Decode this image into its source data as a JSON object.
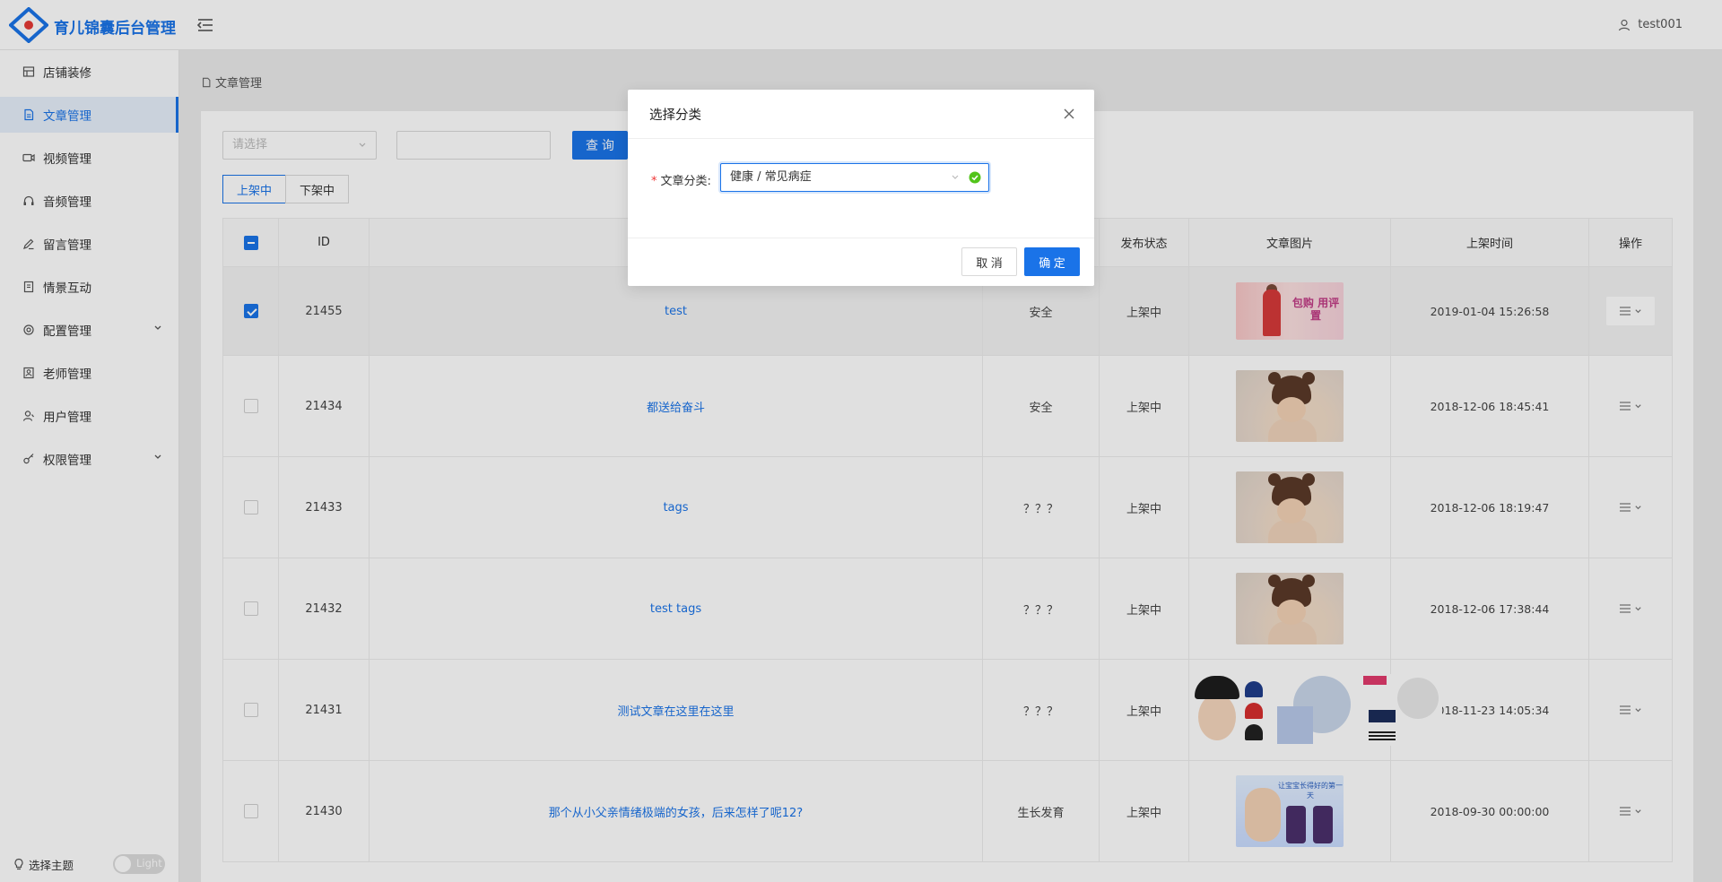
{
  "app": {
    "brand": "育儿锦囊后台管理",
    "user": "test001"
  },
  "sidebar": {
    "items": [
      {
        "label": "店铺装修",
        "icon": "store-icon"
      },
      {
        "label": "文章管理",
        "icon": "document-icon",
        "active": true
      },
      {
        "label": "视频管理",
        "icon": "video-icon"
      },
      {
        "label": "音频管理",
        "icon": "audio-icon"
      },
      {
        "label": "留言管理",
        "icon": "comment-icon"
      },
      {
        "label": "情景互动",
        "icon": "book-icon"
      },
      {
        "label": "配置管理",
        "icon": "settings-icon",
        "expandable": true
      },
      {
        "label": "老师管理",
        "icon": "teacher-icon"
      },
      {
        "label": "用户管理",
        "icon": "user-icon"
      },
      {
        "label": "权限管理",
        "icon": "key-icon",
        "expandable": true
      }
    ],
    "theme_label": "选择主题",
    "theme_toggle": "Light"
  },
  "breadcrumb": "文章管理",
  "filters": {
    "category_placeholder": "请选择",
    "keyword_value": "",
    "query_button": "查 询"
  },
  "tabs": [
    "上架中",
    "下架中"
  ],
  "table": {
    "headers": [
      "ID",
      "",
      "",
      "发布状态",
      "文章图片",
      "上架时间",
      "操作"
    ],
    "rows": [
      {
        "id": "21455",
        "title": "test",
        "category": "安全",
        "status": "上架中",
        "time": "2019-01-04 15:26:58",
        "checked": true
      },
      {
        "id": "21434",
        "title": "都送给奋斗",
        "category": "安全",
        "status": "上架中",
        "time": "2018-12-06 18:45:41",
        "checked": false
      },
      {
        "id": "21433",
        "title": "tags",
        "category": "？？？",
        "status": "上架中",
        "time": "2018-12-06 18:19:47",
        "checked": false
      },
      {
        "id": "21432",
        "title": "test tags",
        "category": "？？？",
        "status": "上架中",
        "time": "2018-12-06 17:38:44",
        "checked": false
      },
      {
        "id": "21431",
        "title": "测试文章在这里在这里",
        "category": "？？？",
        "status": "上架中",
        "time": "2018-11-23 14:05:34",
        "checked": false
      },
      {
        "id": "21430",
        "title": "那个从小父亲情绪极端的女孩，后来怎样了呢12?",
        "category": "生长发育",
        "status": "上架中",
        "time": "2018-09-30 00:00:00",
        "checked": false
      }
    ],
    "promo_text": "包购 用评置",
    "milk_text": "让宝宝长得好的第一天"
  },
  "dialog": {
    "title": "选择分类",
    "label": "文章分类:",
    "value": "健康 / 常见病症",
    "cancel": "取 消",
    "confirm": "确 定"
  },
  "colors": {
    "accent": "#1a73e8",
    "success": "#52c41a",
    "required": "#e33333"
  }
}
